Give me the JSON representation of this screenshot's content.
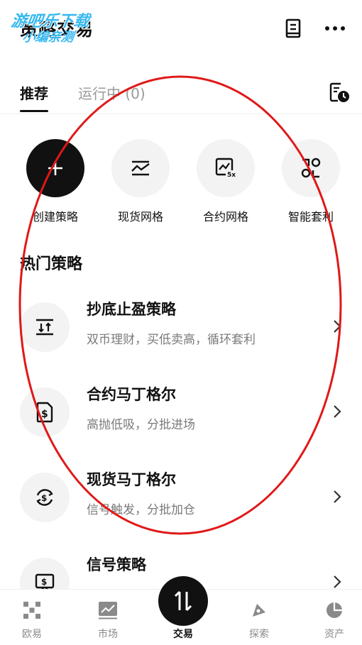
{
  "header": {
    "title": "策略交易",
    "watermark_line1": "游吧乐下载",
    "watermark_line2": "小编亲测",
    "book_icon": "book-icon",
    "more_icon": "more-icon"
  },
  "tabs": [
    {
      "label": "推荐",
      "active": true
    },
    {
      "label": "运行中 (0)",
      "active": false
    }
  ],
  "history_icon": "history-clock-icon",
  "quick_actions": [
    {
      "label": "创建策略",
      "icon": "plus-icon"
    },
    {
      "label": "现货网格",
      "icon": "grid-chart-icon"
    },
    {
      "label": "合约网格",
      "icon": "leverage-grid-icon",
      "badge": "5x"
    },
    {
      "label": "智能套利",
      "icon": "arbitrage-icon"
    }
  ],
  "section": {
    "title": "热门策略"
  },
  "strategies": [
    {
      "name": "抄底止盈策略",
      "desc": "双币理财，买低卖高，循环套利",
      "icon": "bottom-top-icon"
    },
    {
      "name": "合约马丁格尔",
      "desc": "高抛低吸，分批进场",
      "icon": "dollar-doc-icon"
    },
    {
      "name": "现货马丁格尔",
      "desc": "信号触发，分批加仓",
      "icon": "dollar-cycle-icon"
    },
    {
      "name": "信号策略",
      "desc": "",
      "icon": "signal-dollar-icon"
    }
  ],
  "bottom_nav": [
    {
      "label": "欧易",
      "icon": "okx-logo-icon",
      "active": false
    },
    {
      "label": "市场",
      "icon": "market-chart-icon",
      "active": false
    },
    {
      "label": "交易",
      "icon": "trade-arrows-icon",
      "active": true
    },
    {
      "label": "探索",
      "icon": "explore-compass-icon",
      "active": false
    },
    {
      "label": "资产",
      "icon": "assets-pie-icon",
      "active": false
    }
  ],
  "colors": {
    "primary": "#111111",
    "muted": "#7a7a7a",
    "circle_bg": "#f3f3f3",
    "annotation_red": "#e01818",
    "watermark_blue": "#35b8f0"
  }
}
